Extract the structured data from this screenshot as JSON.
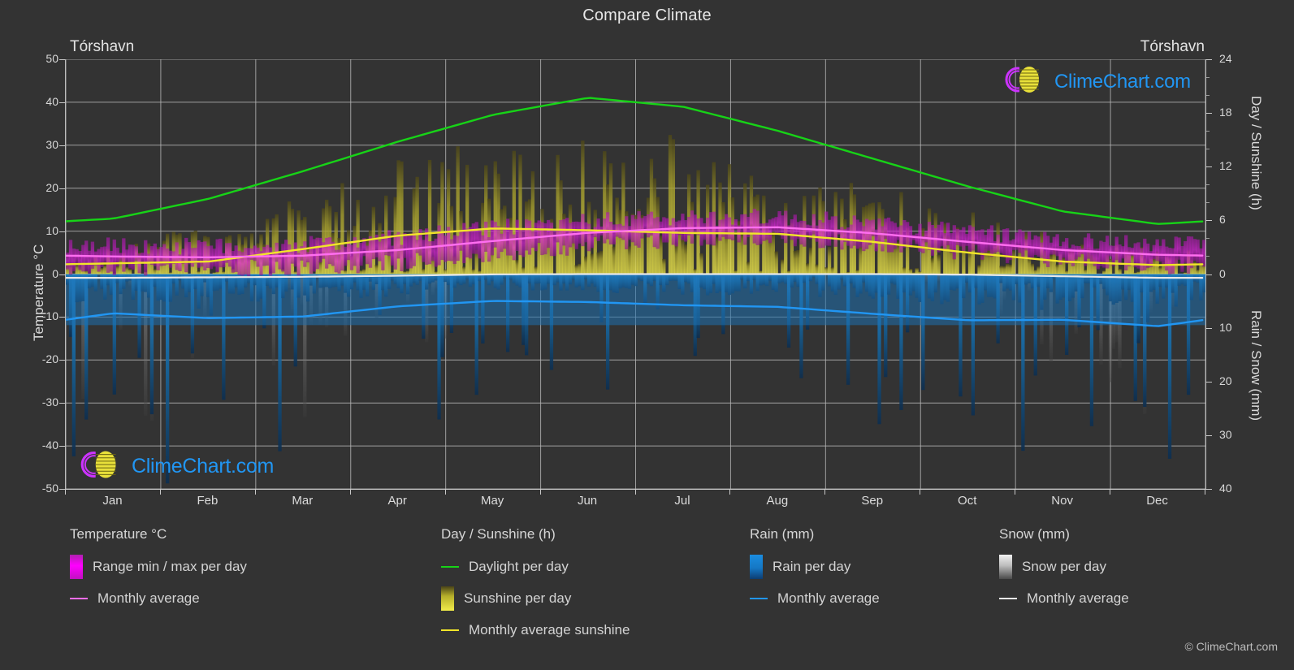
{
  "header": {
    "title": "Compare Climate",
    "left_location": "Tórshavn",
    "right_location": "Tórshavn"
  },
  "branding": {
    "logo_text": "ClimeChart.com",
    "copyright": "© ClimeChart.com",
    "logo_ring_color": "#cc33ff",
    "logo_globe_color": "#e8e03a",
    "logo_text_color": "#2196f3"
  },
  "axes": {
    "temperature_title": "Temperature °C",
    "day_title": "Day / Sunshine (h)",
    "rain_title": "Rain / Snow (mm)",
    "temperature_ticks": [
      50,
      40,
      30,
      20,
      10,
      0,
      -10,
      -20,
      -30,
      -40,
      -50
    ],
    "day_ticks": [
      24,
      18,
      12,
      6,
      0
    ],
    "rain_ticks": [
      0,
      10,
      20,
      30,
      40
    ],
    "months": [
      "Jan",
      "Feb",
      "Mar",
      "Apr",
      "May",
      "Jun",
      "Jul",
      "Aug",
      "Sep",
      "Oct",
      "Nov",
      "Dec"
    ]
  },
  "legend": {
    "temperature": {
      "heading": "Temperature °C",
      "items": [
        {
          "label": "Range min / max per day",
          "marker": "gradient-box",
          "color": "#ff00ff"
        },
        {
          "label": "Monthly average",
          "marker": "line",
          "color": "#ff6ef0"
        }
      ]
    },
    "day": {
      "heading": "Day / Sunshine (h)",
      "items": [
        {
          "label": "Daylight per day",
          "marker": "line",
          "color": "#17d317"
        },
        {
          "label": "Sunshine per day",
          "marker": "gradient-box",
          "color": "#f2ec4a"
        },
        {
          "label": "Monthly average sunshine",
          "marker": "line",
          "color": "#f2e52a"
        }
      ]
    },
    "rain": {
      "heading": "Rain (mm)",
      "items": [
        {
          "label": "Rain per day",
          "marker": "gradient-box",
          "color": "#1a8de0"
        },
        {
          "label": "Monthly average",
          "marker": "line",
          "color": "#2196f3"
        }
      ]
    },
    "snow": {
      "heading": "Snow (mm)",
      "items": [
        {
          "label": "Snow per day",
          "marker": "gradient-box",
          "color": "#dddddd"
        },
        {
          "label": "Monthly average",
          "marker": "line",
          "color": "#e8e8e8"
        }
      ]
    }
  },
  "chart_data": {
    "type": "line",
    "title": "Compare Climate",
    "subtitle": "Tórshavn",
    "xlabel": "",
    "ylabel": "Temperature °C",
    "categories": [
      "Jan",
      "Feb",
      "Mar",
      "Apr",
      "May",
      "Jun",
      "Jul",
      "Aug",
      "Sep",
      "Oct",
      "Nov",
      "Dec"
    ],
    "axis_ranges": {
      "temperature_c": [
        -50,
        50
      ],
      "day_sunshine_h": [
        0,
        24
      ],
      "rain_snow_mm": [
        0,
        40
      ]
    },
    "grid": true,
    "legend_position": "below",
    "series": [
      {
        "name": "Daylight per day",
        "unit": "h",
        "color": "#17d317",
        "axis": "day_sunshine_h",
        "values": [
          6.2,
          8.4,
          11.5,
          14.8,
          17.8,
          19.7,
          18.7,
          16.0,
          12.9,
          9.8,
          7.0,
          5.6
        ]
      },
      {
        "name": "Monthly average sunshine",
        "unit": "h",
        "color": "#f2e52a",
        "axis": "day_sunshine_h",
        "values": [
          1.2,
          1.4,
          2.8,
          4.3,
          5.1,
          4.9,
          4.6,
          4.5,
          3.6,
          2.4,
          1.4,
          1.0
        ]
      },
      {
        "name": "Monthly average temperature",
        "unit": "°C",
        "color": "#ff6ef0",
        "axis": "temperature_c",
        "values": [
          4.1,
          3.9,
          4.3,
          5.6,
          7.7,
          9.6,
          10.7,
          10.9,
          9.5,
          7.5,
          5.6,
          4.5
        ]
      },
      {
        "name": "Rain monthly average",
        "unit": "mm",
        "color": "#2196f3",
        "axis": "rain_snow_mm",
        "values": [
          7.3,
          8.2,
          7.9,
          6.0,
          5.0,
          5.2,
          5.8,
          6.1,
          7.4,
          8.6,
          8.5,
          9.7
        ]
      },
      {
        "name": "Snow monthly average",
        "unit": "mm",
        "color": "#e8e8e8",
        "axis": "rain_snow_mm",
        "values": [
          0.7,
          0.6,
          0.5,
          0.3,
          0.05,
          0.0,
          0.0,
          0.0,
          0.0,
          0.1,
          0.4,
          0.7
        ]
      }
    ],
    "daily_bands": {
      "temperature_range_min": [
        1.5,
        1.2,
        1.6,
        2.6,
        4.6,
        6.8,
        8.2,
        8.4,
        7.0,
        5.0,
        3.1,
        2.0
      ],
      "temperature_range_max": [
        6.6,
        6.4,
        6.8,
        8.4,
        10.7,
        12.3,
        13.2,
        13.3,
        11.8,
        9.8,
        8.0,
        7.0
      ],
      "sunshine_max_h": [
        3.5,
        6.0,
        9.5,
        13.0,
        15.5,
        16.5,
        15.5,
        13.0,
        10.0,
        7.0,
        4.0,
        3.0
      ],
      "rain_max_mm": [
        38,
        40,
        38,
        30,
        25,
        22,
        24,
        26,
        33,
        36,
        38,
        40
      ],
      "snow_max_mm": [
        30,
        34,
        28,
        18,
        6,
        0,
        0,
        0,
        0,
        5,
        22,
        35
      ]
    }
  }
}
